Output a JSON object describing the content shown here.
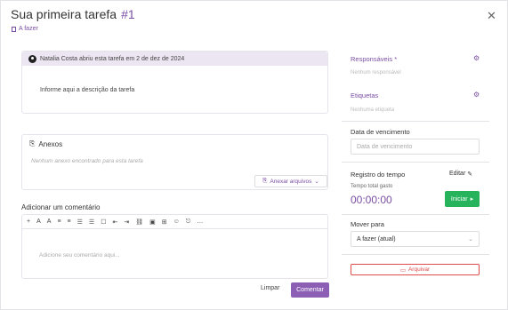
{
  "header": {
    "title": "Sua primeira tarefa",
    "number": "#1",
    "status": "A fazer"
  },
  "description": {
    "opened_by": "Natalia Costa abriu esta tarefa em 2 de dez de 2024",
    "text": "Informe aqui a descrição da tarefa"
  },
  "attachments": {
    "title": "Anexos",
    "empty": "Nenhum anexo encontrado para esta tarefa",
    "button": "Anexar arquivos"
  },
  "comment": {
    "label": "Adicionar um comentário",
    "placeholder": "Adicione seu comentário aqui...",
    "clear": "Limpar",
    "submit": "Comentar"
  },
  "toolbar": {
    "items": [
      "+",
      "A",
      "A",
      "≡",
      "≡",
      "☰",
      "☰",
      "☐",
      "⇤",
      "⇥",
      "⛓",
      "▣",
      "⊞",
      "☺",
      "⎋",
      "…"
    ]
  },
  "sidebar": {
    "responsaveis_label": "Responsáveis *",
    "responsaveis_value": "Nenhum responsável",
    "etiquetas_label": "Etiquetas",
    "etiquetas_value": "Nenhuma etiqueta",
    "vencimento_label": "Data de vencimento",
    "vencimento_placeholder": "Data de vencimento",
    "registro_label": "Registro do tempo",
    "editar": "Editar",
    "tempo_label": "Tempo total gasto",
    "tempo_value": "00:00:00",
    "iniciar": "Iniciar",
    "mover_label": "Mover para",
    "mover_value": "A fazer (atual)",
    "arquivar": "Arquivar"
  },
  "colors": {
    "accent": "#7b4ea3",
    "success": "#27b35c",
    "danger": "#e04b4b"
  }
}
